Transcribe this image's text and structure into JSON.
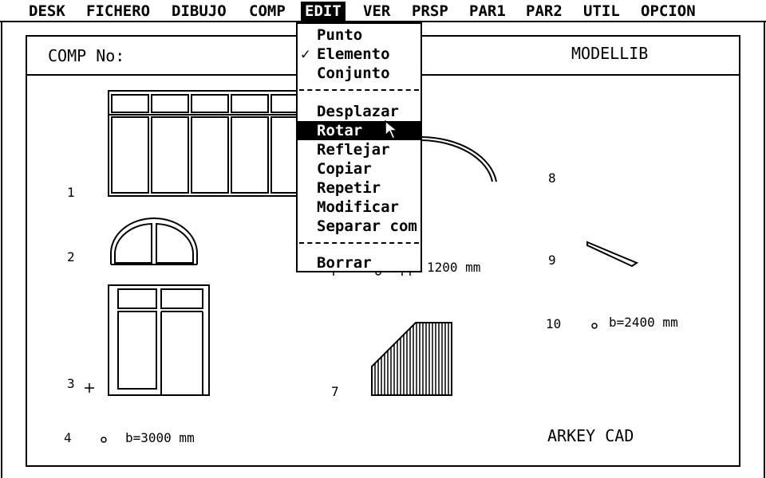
{
  "menubar": {
    "items": [
      "DESK",
      "FICHERO",
      "DIBUJO",
      "COMP",
      "EDIT",
      "VER",
      "PRSP",
      "PAR1",
      "PAR2",
      "UTIL",
      "OPCION"
    ],
    "active": "EDIT"
  },
  "sheet": {
    "left_title": "COMP No:",
    "right_title": "MODELLIB",
    "footer_brand": "ARKEY CAD"
  },
  "components": {
    "n1": "1",
    "n2": "2",
    "n3": "3",
    "n4": "4",
    "n4_dim": "b=3000 mm",
    "n6_dim": "1200 mm",
    "n7": "7",
    "n8": "8",
    "n9": "9",
    "n10": "10",
    "n10_dim": "b=2400 mm"
  },
  "edit_menu": {
    "items": [
      {
        "label": "Punto",
        "checked": false,
        "highlighted": false
      },
      {
        "label": "Elemento",
        "checked": true,
        "highlighted": false
      },
      {
        "label": "Conjunto",
        "checked": false,
        "highlighted": false
      },
      {
        "label": "Desplazar",
        "checked": false,
        "highlighted": false
      },
      {
        "label": "Rotar",
        "checked": false,
        "highlighted": true
      },
      {
        "label": "Reflejar",
        "checked": false,
        "highlighted": false
      },
      {
        "label": "Copiar",
        "checked": false,
        "highlighted": false
      },
      {
        "label": "Repetir",
        "checked": false,
        "highlighted": false
      },
      {
        "label": "Modificar",
        "checked": false,
        "highlighted": false
      },
      {
        "label": "Separar com",
        "checked": false,
        "highlighted": false
      },
      {
        "label": "Borrar",
        "checked": false,
        "highlighted": false
      }
    ],
    "check_glyph": "✓"
  },
  "icons": [
    "mouse-pointer-icon"
  ]
}
